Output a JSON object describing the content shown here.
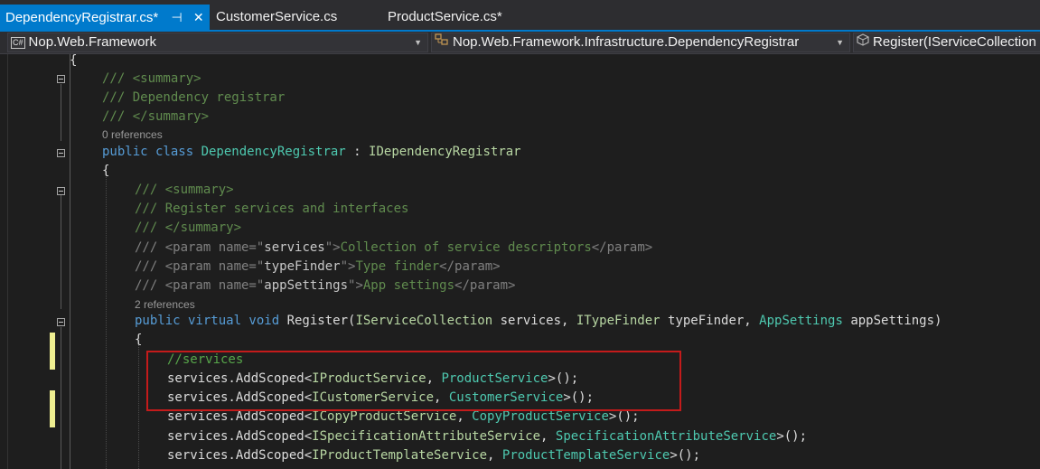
{
  "tabs": [
    {
      "label": "DependencyRegistrar.cs*",
      "active": true
    },
    {
      "label": "CustomerService.cs",
      "active": false
    },
    {
      "label": "ProductService.cs*",
      "active": false
    }
  ],
  "tab_icons": {
    "pin": "⊣",
    "close": "✕"
  },
  "navigation": {
    "project": "Nop.Web.Framework",
    "project_badge": "C#",
    "type": "Nop.Web.Framework.Infrastructure.DependencyRegistrar",
    "member": "Register(IServiceCollection"
  },
  "code": {
    "l_open": "{",
    "l_sum1": "/// <summary>",
    "l_sum2": "/// Dependency registrar",
    "l_sum3": "/// </summary>",
    "refs_class": "0 references",
    "l_class": "public class DependencyRegistrar : IDependencyRegistrar",
    "l_open2": "{",
    "l_msum1": "/// <summary>",
    "l_msum2": "/// Register services and interfaces",
    "l_msum3": "/// </summary>",
    "l_p1": "/// <param name=\"services\">Collection of service descriptors</param>",
    "l_p2": "/// <param name=\"typeFinder\">Type finder</param>",
    "l_p3": "/// <param name=\"appSettings\">App settings</param>",
    "refs_method": "2 references",
    "l_method": "public virtual void Register(IServiceCollection services, ITypeFinder typeFinder, AppSettings appSettings)",
    "l_open3": "{",
    "l_c1": "//services",
    "l_c2": "services.AddScoped<IProductService, ProductService>();",
    "l_c3": "services.AddScoped<ICustomerService, CustomerService>();",
    "l_c4": "services.AddScoped<ICopyProductService, CopyProductService>();",
    "l_c5": "services.AddScoped<ISpecificationAttributeService, SpecificationAttributeService>();",
    "l_c6": "services.AddScoped<IProductTemplateService, ProductTemplateService>();"
  },
  "colors": {
    "accent": "#007acc",
    "highlight_border": "#c41b1b",
    "change_marker": "#efef91"
  }
}
